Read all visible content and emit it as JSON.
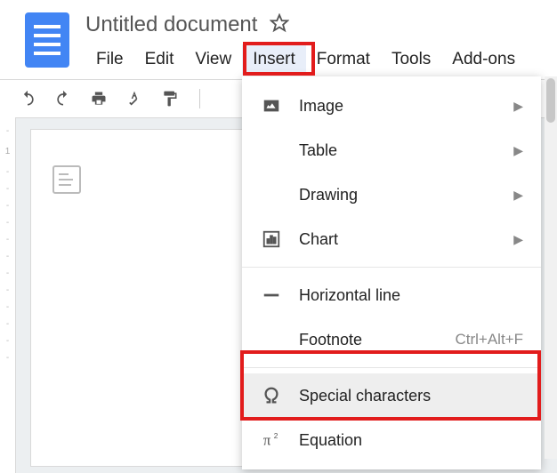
{
  "title": "Untitled document",
  "menubar": {
    "file": "File",
    "edit": "Edit",
    "view": "View",
    "insert": "Insert",
    "format": "Format",
    "tools": "Tools",
    "addons": "Add-ons"
  },
  "dropdown": {
    "image": "Image",
    "table": "Table",
    "drawing": "Drawing",
    "chart": "Chart",
    "horizontal_line": "Horizontal line",
    "footnote": "Footnote",
    "footnote_shortcut": "Ctrl+Alt+F",
    "special_characters": "Special characters",
    "equation": "Equation"
  },
  "ruler": {
    "mark1": "1"
  }
}
